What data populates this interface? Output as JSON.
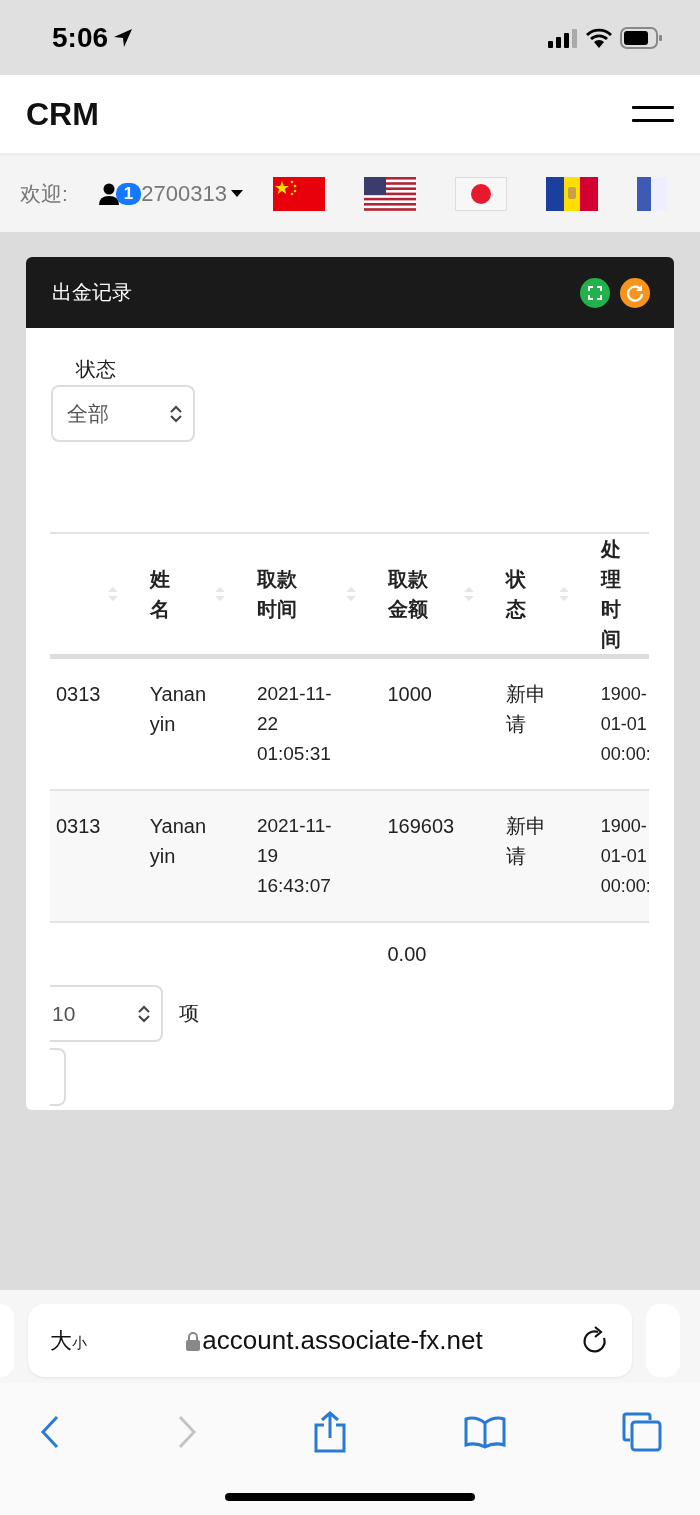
{
  "status_bar": {
    "time": "5:06"
  },
  "navbar": {
    "brand": "CRM"
  },
  "welcome": {
    "label": "欢迎:",
    "badge": "1",
    "account": "2700313"
  },
  "languages": [
    {
      "kind": "cn"
    },
    {
      "kind": "us"
    },
    {
      "kind": "jp"
    },
    {
      "kind": "ad"
    },
    {
      "kind": "fr"
    }
  ],
  "panel": {
    "title": "出金记录"
  },
  "filter": {
    "label": "状态",
    "value": "全部"
  },
  "table": {
    "columns": [
      {
        "kind": "cut"
      },
      {
        "kind": "text",
        "label": "姓名"
      },
      {
        "kind": "text",
        "label": "取款时间"
      },
      {
        "kind": "text",
        "label": "取款金额"
      },
      {
        "kind": "text",
        "label": "状态"
      },
      {
        "kind": "text",
        "label": "处理时间"
      }
    ],
    "rows": [
      {
        "cells": [
          "0313",
          "Yanan yin",
          "2021-11-22 01:05:31",
          "1000",
          "新申请",
          "1900-01-01 00:00:"
        ]
      },
      {
        "cells": [
          "0313",
          "Yanan yin",
          "2021-11-19 16:43:07",
          "169603",
          "新申请",
          "1900-01-01 00:00:"
        ]
      }
    ],
    "total_amount": "0.00"
  },
  "page_length": {
    "value": "10",
    "suffix": "项"
  },
  "browser": {
    "text_size_big": "大",
    "text_size_small": "小",
    "url": "account.associate-fx.net",
    "back_enabled": true,
    "forward_enabled": false
  }
}
